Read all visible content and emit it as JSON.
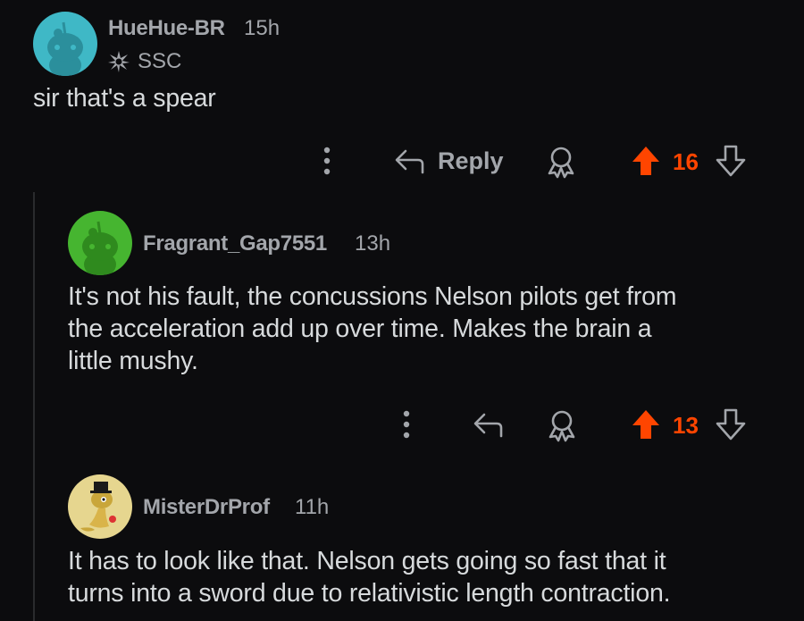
{
  "colors": {
    "background": "#0c0c0e",
    "text": "#d7dadc",
    "meta": "#a3a6ab",
    "upvote": "#ff4500"
  },
  "comments": [
    {
      "username": "HueHue-BR",
      "time": "15h",
      "flair": "SSC",
      "body": "sir that's a spear",
      "actions": {
        "reply_label": "Reply",
        "score": "16"
      },
      "avatar_icon": "snoo-avatar-teal"
    },
    {
      "username": "Fragrant_Gap7551",
      "time": "13h",
      "body_lines": [
        "It's not his fault, the concussions Nelson pilots get from",
        "the acceleration add up over time. Makes the brain a",
        "little mushy."
      ],
      "actions": {
        "score": "13"
      },
      "avatar_icon": "snoo-avatar-green"
    },
    {
      "username": "MisterDrProf",
      "time": "11h",
      "body_lines": [
        "It has to look like that. Nelson gets going so fast that it",
        "turns into a sword due to relativistic length contraction."
      ],
      "avatar_icon": "snoo-avatar-tophat"
    }
  ]
}
